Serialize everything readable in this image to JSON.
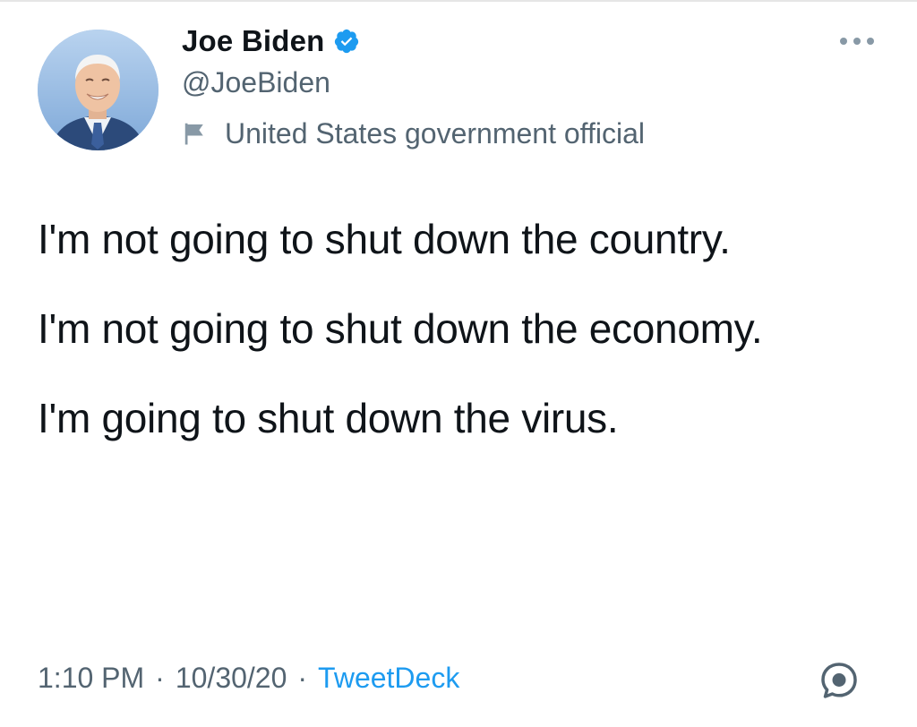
{
  "author": {
    "display_name": "Joe Biden",
    "handle": "@JoeBiden",
    "label": "United States government official",
    "verified_icon": "verified-badge-icon",
    "label_icon": "flag-icon"
  },
  "tweet": {
    "paragraphs": [
      "I'm not going to shut down the country.",
      "I'm not going to shut down the economy.",
      "I'm going to shut down the virus."
    ]
  },
  "meta": {
    "time": "1:10 PM",
    "separator": "·",
    "date": "10/30/20",
    "source": "TweetDeck"
  },
  "colors": {
    "verified": "#1d9bf0",
    "secondary_text": "#536471",
    "link": "#1d9bf0"
  },
  "icons": {
    "more": "more-options-icon",
    "conversation": "conversation-icon"
  }
}
